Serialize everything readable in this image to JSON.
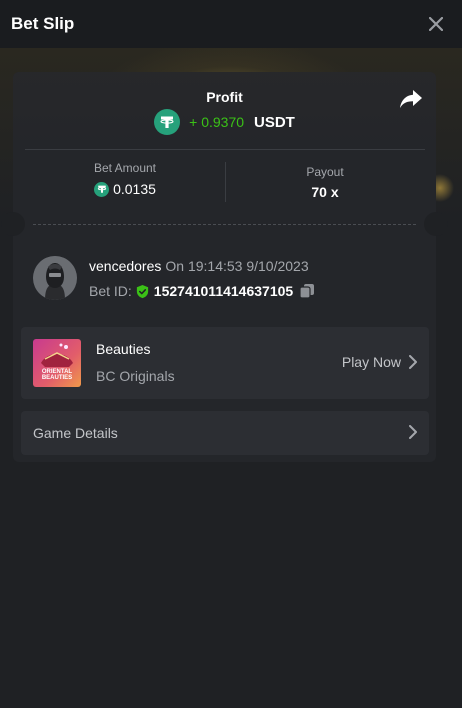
{
  "header": {
    "title": "Bet Slip"
  },
  "profit": {
    "label": "Profit",
    "value": "+ 0.9370",
    "currency": "USDT"
  },
  "bet_amount": {
    "label": "Bet Amount",
    "value": "0.0135"
  },
  "payout": {
    "label": "Payout",
    "value": "70 x"
  },
  "user": {
    "name": "vencedores",
    "timestamp": "On 19:14:53 9/10/2023",
    "bet_id_label": "Bet ID:",
    "bet_id": "152741011414637105"
  },
  "game": {
    "thumbnail_text": "ORIENTAL BEAUTIES",
    "name": "Beauties",
    "provider": "BC Originals",
    "play_label": "Play Now"
  },
  "details": {
    "label": "Game Details"
  },
  "colors": {
    "accent_green": "#3bc117",
    "tether": "#26a17b",
    "background": "#1f2124"
  },
  "icons": [
    "close-icon",
    "share-icon",
    "tether-icon",
    "shield-check-icon",
    "copy-icon",
    "chevron-right-icon"
  ]
}
